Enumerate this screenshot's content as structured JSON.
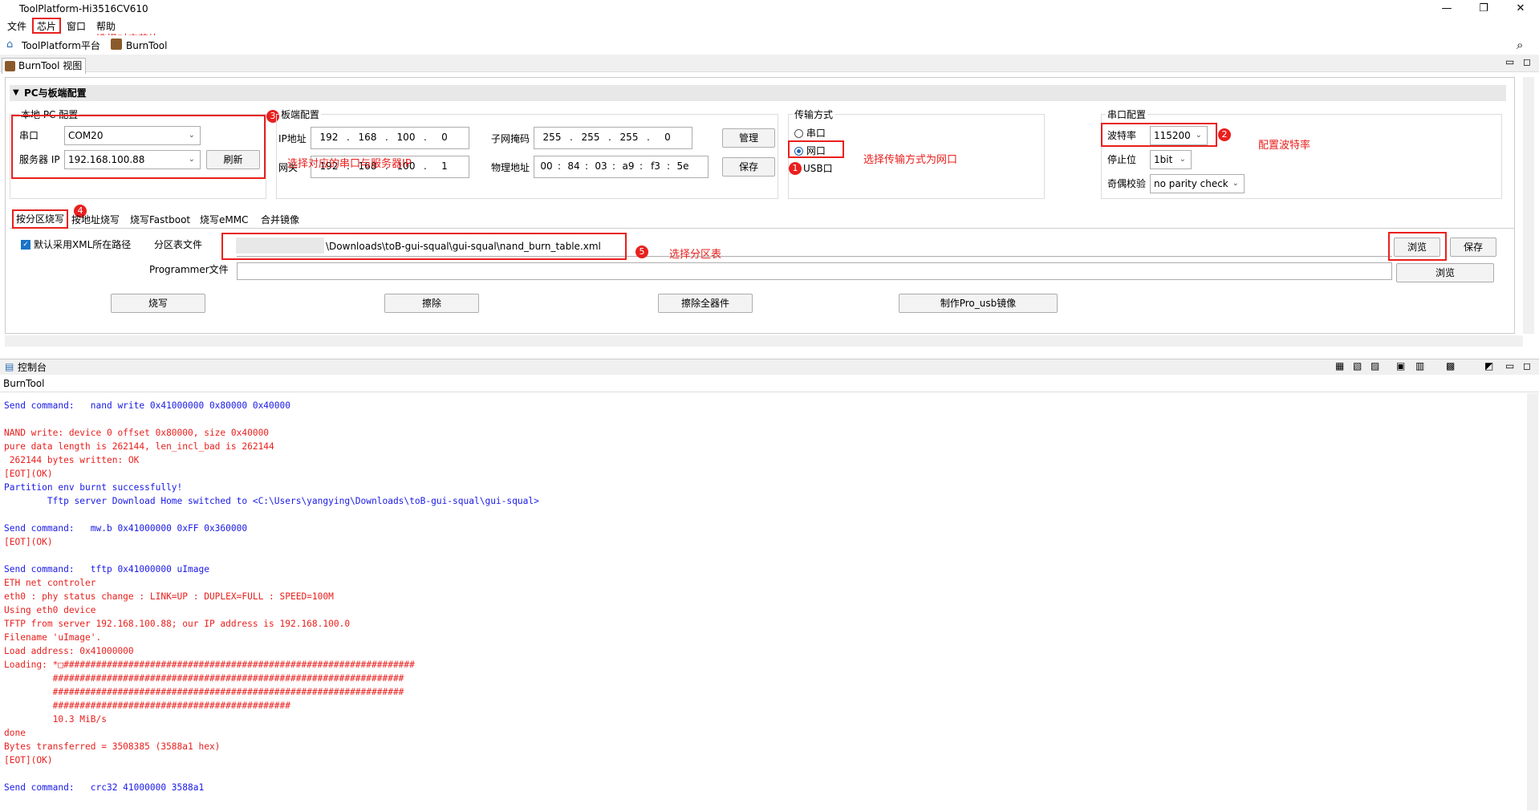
{
  "window": {
    "title": "ToolPlatform-Hi3516CV610",
    "min": "—",
    "max": "❐",
    "close": "✕"
  },
  "menu": {
    "items": [
      "文件",
      "芯片",
      "窗口",
      "帮助"
    ]
  },
  "annotations": {
    "a_chip": "选择对应芯片",
    "a_port": "选择对应的串口与服务器IP",
    "a_trans": "选择传输方式为网口",
    "a_baud": "配置波特率",
    "a_part": "选择分区表",
    "n1": "1",
    "n2": "2",
    "n3": "3",
    "n4": "4",
    "n5": "5"
  },
  "toolbar": {
    "platform": "ToolPlatform平台",
    "burntool": "BurnTool"
  },
  "view_tab": "BurnTool 视图",
  "section_title": "PC与板端配置",
  "local_pc": {
    "title": "本地 PC 配置",
    "port_label": "串口",
    "port_value": "COM20",
    "server_label": "服务器 IP",
    "server_value": "192.168.100.88",
    "refresh": "刷新"
  },
  "board": {
    "title": "板端配置",
    "ip_label": "IP地址",
    "ip": [
      "192",
      "168",
      "100",
      "0"
    ],
    "gw_label": "网关",
    "gw": [
      "192",
      "168",
      "100",
      "1"
    ],
    "mask_label": "子网掩码",
    "mask": [
      "255",
      "255",
      "255",
      "0"
    ],
    "mac_label": "物理地址",
    "mac": [
      "00",
      "84",
      "03",
      "a9",
      "f3",
      "5e"
    ],
    "manage": "管理",
    "save": "保存"
  },
  "transfer": {
    "title": "传输方式",
    "serial": "串口",
    "net": "网口",
    "usb": "USB口"
  },
  "serial_cfg": {
    "title": "串口配置",
    "baud_label": "波特率",
    "baud_value": "115200",
    "stop_label": "停止位",
    "stop_value": "1bit",
    "parity_label": "奇偶校验",
    "parity_value": "no parity check"
  },
  "tabs": [
    "按分区烧写",
    "按地址烧写",
    "烧写Fastboot",
    "烧写eMMC",
    "合并镜像"
  ],
  "burn": {
    "xml_check": "默认采用XML所在路径",
    "part_label": "分区表文件",
    "part_value": "\\Downloads\\toB-gui-squal\\gui-squal\\nand_burn_table.xml",
    "browse": "浏览",
    "save": "保存",
    "prog_label": "Programmer文件",
    "browse2": "浏览",
    "btn_burn": "烧写",
    "btn_erase": "擦除",
    "btn_erase_all": "擦除全器件",
    "btn_pro": "制作Pro_usb镜像"
  },
  "console": {
    "title": "控制台",
    "sub": "BurnTool"
  },
  "log": [
    {
      "c": "#1a1ae6",
      "t": "Send command:   nand write 0x41000000 0x80000 0x40000"
    },
    {
      "c": "#e8201e",
      "t": ""
    },
    {
      "c": "#e8201e",
      "t": "NAND write: device 0 offset 0x80000, size 0x40000"
    },
    {
      "c": "#e8201e",
      "t": "pure data length is 262144, len_incl_bad is 262144"
    },
    {
      "c": "#e8201e",
      "t": " 262144 bytes written: OK"
    },
    {
      "c": "#e8201e",
      "t": "[EOT](OK)"
    },
    {
      "c": "#1a1ae6",
      "t": "Partition env burnt successfully!"
    },
    {
      "c": "#1a1ae6",
      "t": "        Tftp server Download Home switched to <C:\\Users\\yangying\\Downloads\\toB-gui-squal\\gui-squal>"
    },
    {
      "c": "#1a1ae6",
      "t": ""
    },
    {
      "c": "#1a1ae6",
      "t": "Send command:   mw.b 0x41000000 0xFF 0x360000"
    },
    {
      "c": "#e8201e",
      "t": "[EOT](OK)"
    },
    {
      "c": "#1a1ae6",
      "t": ""
    },
    {
      "c": "#1a1ae6",
      "t": "Send command:   tftp 0x41000000 uImage"
    },
    {
      "c": "#e8201e",
      "t": "ETH net controler"
    },
    {
      "c": "#e8201e",
      "t": "eth0 : phy status change : LINK=UP : DUPLEX=FULL : SPEED=100M"
    },
    {
      "c": "#e8201e",
      "t": "Using eth0 device"
    },
    {
      "c": "#e8201e",
      "t": "TFTP from server 192.168.100.88; our IP address is 192.168.100.0"
    },
    {
      "c": "#e8201e",
      "t": "Filename 'uImage'."
    },
    {
      "c": "#e8201e",
      "t": "Load address: 0x41000000"
    },
    {
      "c": "#e8201e",
      "t": "Loading: *□#################################################################"
    },
    {
      "c": "#e8201e",
      "t": "         #################################################################"
    },
    {
      "c": "#e8201e",
      "t": "         #################################################################"
    },
    {
      "c": "#e8201e",
      "t": "         ############################################"
    },
    {
      "c": "#e8201e",
      "t": "         10.3 MiB/s"
    },
    {
      "c": "#e8201e",
      "t": "done"
    },
    {
      "c": "#e8201e",
      "t": "Bytes transferred = 3508385 (3588a1 hex)"
    },
    {
      "c": "#e8201e",
      "t": "[EOT](OK)"
    },
    {
      "c": "#1a1ae6",
      "t": ""
    },
    {
      "c": "#1a1ae6",
      "t": "Send command:   crc32 41000000 3588a1"
    }
  ]
}
